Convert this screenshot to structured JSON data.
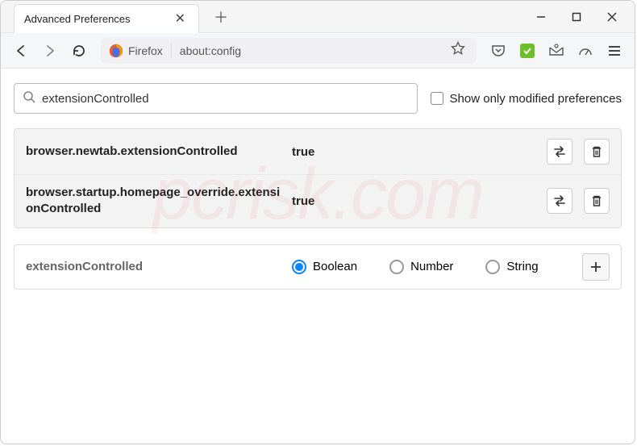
{
  "tab": {
    "title": "Advanced Preferences"
  },
  "urlbar": {
    "identity": "Firefox",
    "value": "about:config"
  },
  "search": {
    "value": "extensionControlled",
    "checkbox_label": "Show only modified preferences",
    "checkbox_checked": false
  },
  "results": [
    {
      "name": "browser.newtab.extensionControlled",
      "value": "true"
    },
    {
      "name": "browser.startup.homepage_override.extensionControlled",
      "value": "true"
    }
  ],
  "add_row": {
    "name": "extensionControlled",
    "types": [
      {
        "label": "Boolean",
        "selected": true
      },
      {
        "label": "Number",
        "selected": false
      },
      {
        "label": "String",
        "selected": false
      }
    ]
  },
  "watermark": "pcrisk.com"
}
